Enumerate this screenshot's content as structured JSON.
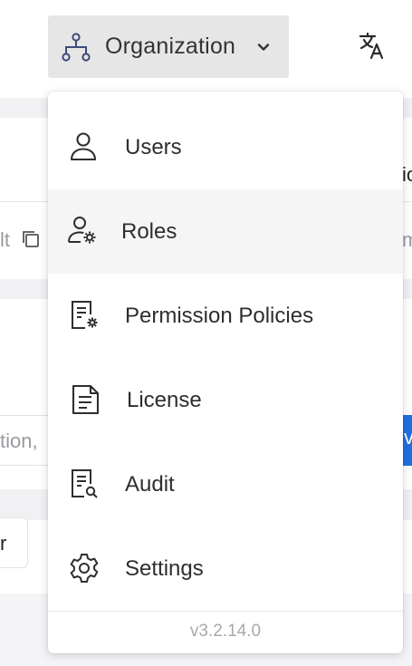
{
  "header": {
    "org_label": "Organization",
    "org_icon": "org-tree-icon",
    "chevron_icon": "chevron-down-icon",
    "lang_icon": "translate-icon"
  },
  "menu": {
    "items": [
      {
        "label": "Users",
        "icon": "user-icon"
      },
      {
        "label": "Roles",
        "icon": "user-gear-icon",
        "hovered": true
      },
      {
        "label": "Permission Policies",
        "icon": "document-gear-icon"
      },
      {
        "label": "License",
        "icon": "document-icon"
      },
      {
        "label": "Audit",
        "icon": "document-search-icon"
      },
      {
        "label": "Settings",
        "icon": "gear-icon"
      }
    ],
    "version": "v3.2.14.0"
  },
  "background": {
    "frag_lt": "lt",
    "frag_ic": "ic",
    "frag_mi": "mi",
    "frag_tion": "tion,",
    "frag_vi": "vi",
    "frag_r": "r"
  },
  "colors": {
    "header_button_bg": "#e6e6e6",
    "menu_hover_bg": "#f5f5f5",
    "accent_blue": "#1f6fe0",
    "version_text": "#a9a9ad"
  }
}
